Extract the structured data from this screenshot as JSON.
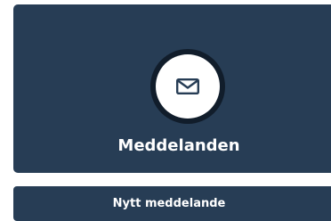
{
  "messages_card": {
    "title": "Meddelanden",
    "icon": "envelope-icon"
  },
  "actions": {
    "new_message_label": "Nytt meddelande"
  },
  "colors": {
    "card_bg": "#273d55",
    "icon_ring": "#111d2b",
    "icon_bg": "#ffffff",
    "icon_fg": "#273d55",
    "text": "#ffffff"
  }
}
